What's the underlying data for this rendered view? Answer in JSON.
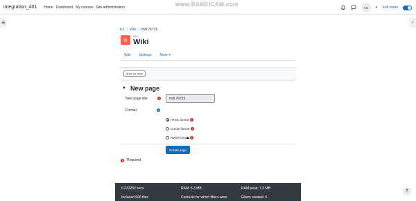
{
  "header": {
    "site_name": "integration_401",
    "nav": [
      "Home",
      "Dashboard",
      "My courses",
      "Site administration"
    ],
    "watermark": "www.BANDICAM.com",
    "avatar": "AU",
    "edit_mode": "Edit mode",
    "edit_mode_on": true
  },
  "breadcrumb": {
    "items": [
      "tc1",
      "Wiki",
      "mdl 76725"
    ],
    "separator": "/"
  },
  "module": {
    "type_label": "WIKI",
    "title": "Wiki",
    "icon": "wiki-icon",
    "accent_color": "#f7634d"
  },
  "tabs": [
    "Wiki",
    "Settings",
    "More"
  ],
  "completion": {
    "mark_done": "Mark as done"
  },
  "form": {
    "section_title": "New page",
    "page_title_label": "New page title",
    "page_title_value": "mdl 76725",
    "format_label": "Format",
    "formats": [
      {
        "label": "HTML format",
        "selected": true
      },
      {
        "label": "Creole format",
        "selected": false
      },
      {
        "label": "NWiki format",
        "selected": false
      }
    ],
    "submit": "Create page",
    "required_note": "Required"
  },
  "footer": {
    "time": "0.232282 secs",
    "ram": "RAM: 6.3 MB",
    "ram_peak": "RAM peak: 7.3 MB",
    "files": "Included 506 files",
    "contexts": "Contexts for which filters were",
    "filters": "Filters created: 6"
  },
  "help_button": "?",
  "colors": {
    "primary": "#0f6cbf",
    "error": "#ca3120",
    "footer": "#343a40"
  }
}
